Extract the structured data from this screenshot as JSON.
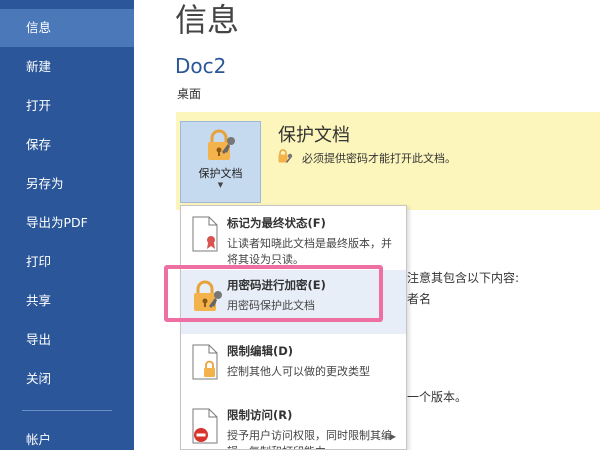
{
  "sidebar": {
    "items": [
      {
        "label": "信息"
      },
      {
        "label": "新建"
      },
      {
        "label": "打开"
      },
      {
        "label": "保存"
      },
      {
        "label": "另存为"
      },
      {
        "label": "导出为PDF"
      },
      {
        "label": "打印"
      },
      {
        "label": "共享"
      },
      {
        "label": "导出"
      },
      {
        "label": "关闭"
      },
      {
        "label": "帐户"
      }
    ]
  },
  "main": {
    "title": "信息",
    "doc_name": "Doc2",
    "doc_path": "桌面",
    "protect": {
      "button_label": "保护文档",
      "heading": "保护文档",
      "description": "必须提供密码才能打开此文档。"
    },
    "background_text": {
      "inspect_line": "注意其包含以下内容:",
      "inspect_sub": "者名",
      "versions_line": "一个版本。"
    }
  },
  "menu": {
    "items": [
      {
        "title": "标记为最终状态(F)",
        "desc": "让读者知晓此文档是最终版本，并将其设为只读。"
      },
      {
        "title": "用密码进行加密(E)",
        "desc": "用密码保护此文档"
      },
      {
        "title": "限制编辑(D)",
        "desc": "控制其他人可以做的更改类型"
      },
      {
        "title": "限制访问(R)",
        "desc": "授予用户访问权限，同时限制其编辑、复制和打印能力。"
      }
    ]
  },
  "colors": {
    "sidebar_bg": "#2b579a",
    "sidebar_active": "#4a78b8",
    "protect_panel": "#fcf6bc",
    "highlight_border": "#ee6fa2"
  }
}
